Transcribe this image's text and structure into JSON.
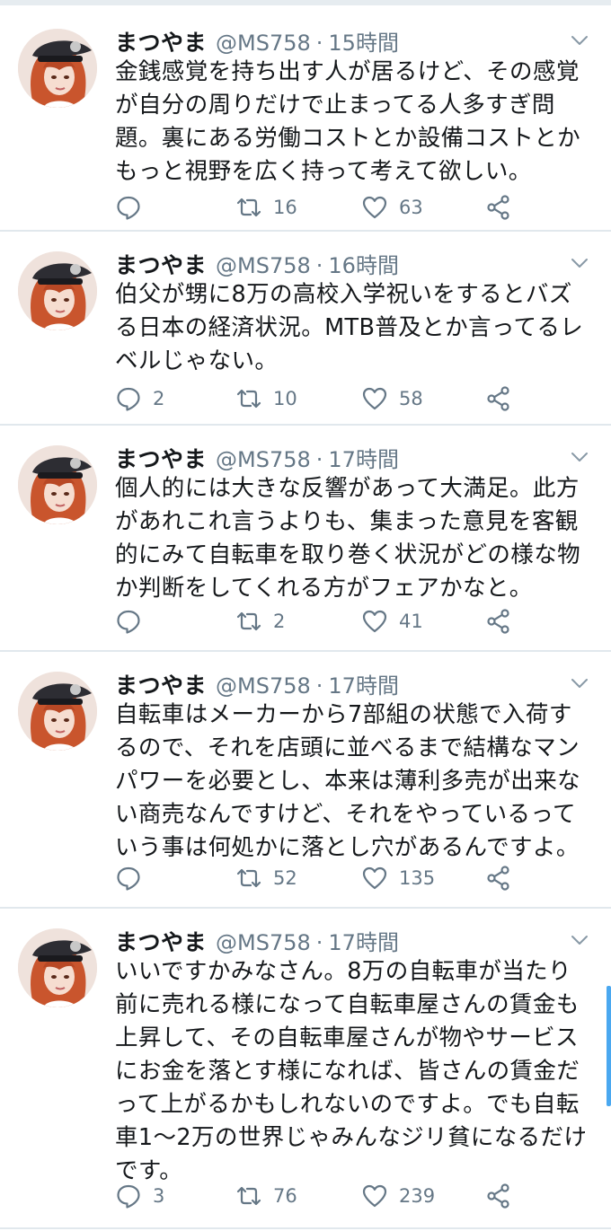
{
  "colors": {
    "text": "#14171a",
    "secondary": "#657786",
    "divider": "#e1e8ed",
    "scroll_indicator": "#4aa8f0"
  },
  "icons": {
    "avatar": "profile-photo",
    "caret": "chevron-down-icon",
    "reply": "reply-icon",
    "retweet": "retweet-icon",
    "like": "heart-icon",
    "share": "share-icon"
  },
  "tweets": [
    {
      "name": "まつやま",
      "handle": "@MS758",
      "separator": "·",
      "time": "15時間",
      "lines": [
        "金銭感覚を持ち出す人が居るけど、その感覚",
        "が自分の周りだけで止まってる人多すぎ問",
        "題。裏にある労働コストとか設備コストとか",
        "もっと視野を広く持って考えて欲しい。"
      ],
      "replies": "",
      "retweets": "16",
      "likes": "63"
    },
    {
      "name": "まつやま",
      "handle": "@MS758",
      "separator": "·",
      "time": "16時間",
      "lines": [
        "伯父が甥に8万の高校入学祝いをするとバズ",
        "る日本の経済状況。MTB普及とか言ってるレ",
        "ベルじゃない。"
      ],
      "replies": "2",
      "retweets": "10",
      "likes": "58"
    },
    {
      "name": "まつやま",
      "handle": "@MS758",
      "separator": "·",
      "time": "17時間",
      "lines": [
        "個人的には大きな反響があって大満足。此方",
        "があれこれ言うよりも、集まった意見を客観",
        "的にみて自転車を取り巻く状況がどの様な物",
        "か判断をしてくれる方がフェアかなと。"
      ],
      "replies": "",
      "retweets": "2",
      "likes": "41"
    },
    {
      "name": "まつやま",
      "handle": "@MS758",
      "separator": "·",
      "time": "17時間",
      "lines": [
        "自転車はメーカーから7部組の状態で入荷す",
        "るので、それを店頭に並べるまで結構なマン",
        "パワーを必要とし、本来は薄利多売が出来な",
        "い商売なんですけど、それをやっているって",
        "いう事は何処かに落とし穴があるんですよ。"
      ],
      "replies": "",
      "retweets": "52",
      "likes": "135"
    },
    {
      "name": "まつやま",
      "handle": "@MS758",
      "separator": "·",
      "time": "17時間",
      "lines": [
        "いいですかみなさん。8万の自転車が当たり",
        "前に売れる様になって自転車屋さんの賃金も",
        "上昇して、その自転車屋さんが物やサービス",
        "にお金を落とす様になれば、皆さんの賃金だ",
        "って上がるかもしれないのですよ。でも自転",
        "車1〜2万の世界じゃみんなジリ貧になるだけ",
        "です。"
      ],
      "replies": "3",
      "retweets": "76",
      "likes": "239"
    }
  ]
}
